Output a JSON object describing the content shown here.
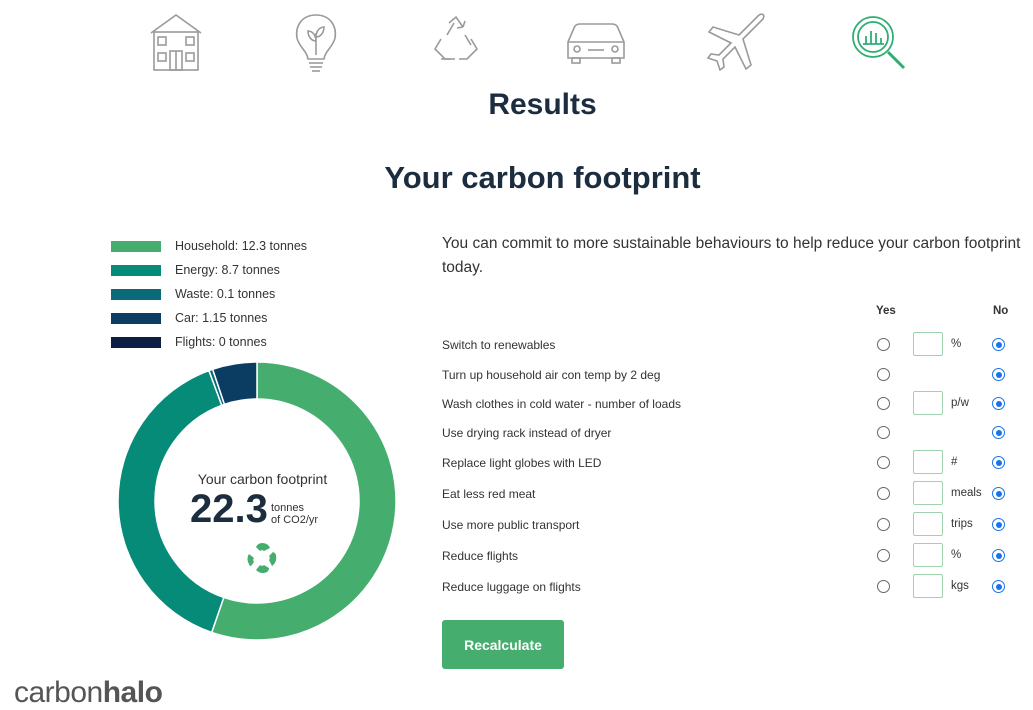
{
  "nav": {
    "steps": [
      {
        "icon": "house-icon"
      },
      {
        "icon": "lightbulb-icon"
      },
      {
        "icon": "recycle-icon"
      },
      {
        "icon": "car-icon"
      },
      {
        "icon": "airplane-icon"
      },
      {
        "icon": "results-magnifier-icon",
        "active": true
      }
    ],
    "inactive_color": "#9a9a9a",
    "active_color": "#2fae74"
  },
  "page_title": "Results",
  "section_title": "Your carbon footprint",
  "legend": [
    {
      "label": "Household: 12.3 tonnes",
      "color": "#45ae6e",
      "value": 12.3
    },
    {
      "label": "Energy: 8.7 tonnes",
      "color": "#058b78",
      "value": 8.7
    },
    {
      "label": "Waste: 0.1 tonnes",
      "color": "#0a6a79",
      "value": 0.1
    },
    {
      "label": "Car: 1.15 tonnes",
      "color": "#0b3d63",
      "value": 1.15
    },
    {
      "label": "Flights: 0 tonnes",
      "color": "#0b1f43",
      "value": 0
    }
  ],
  "donut_center": {
    "caption": "Your carbon footprint",
    "total": "22.3",
    "units_line1": "tonnes",
    "units_line2": "of CO2/yr"
  },
  "intro": "You can commit to more sustainable behaviours to help reduce your carbon footprint today.",
  "columns": {
    "yes": "Yes",
    "no": "No"
  },
  "behaviours": [
    {
      "label": "Switch to renewables",
      "has_input": true,
      "unit": "%",
      "selected": "no"
    },
    {
      "label": "Turn up household air con temp by 2 deg",
      "has_input": false,
      "unit": "",
      "selected": "no"
    },
    {
      "label": "Wash clothes in cold water - number of loads",
      "has_input": true,
      "unit": "p/w",
      "selected": "no"
    },
    {
      "label": "Use drying rack instead of dryer",
      "has_input": false,
      "unit": "",
      "selected": "no"
    },
    {
      "label": "Replace light globes with LED",
      "has_input": true,
      "unit": "#",
      "selected": "no"
    },
    {
      "label": "Eat less red meat",
      "has_input": true,
      "unit": "meals",
      "selected": "no"
    },
    {
      "label": "Use more public transport",
      "has_input": true,
      "unit": "trips",
      "selected": "no"
    },
    {
      "label": "Reduce flights",
      "has_input": true,
      "unit": "%",
      "selected": "no"
    },
    {
      "label": "Reduce luggage on flights",
      "has_input": true,
      "unit": "kgs",
      "selected": "no"
    }
  ],
  "button": {
    "recalculate": "Recalculate"
  },
  "brand": {
    "part1": "carbon",
    "part2": "halo"
  }
}
